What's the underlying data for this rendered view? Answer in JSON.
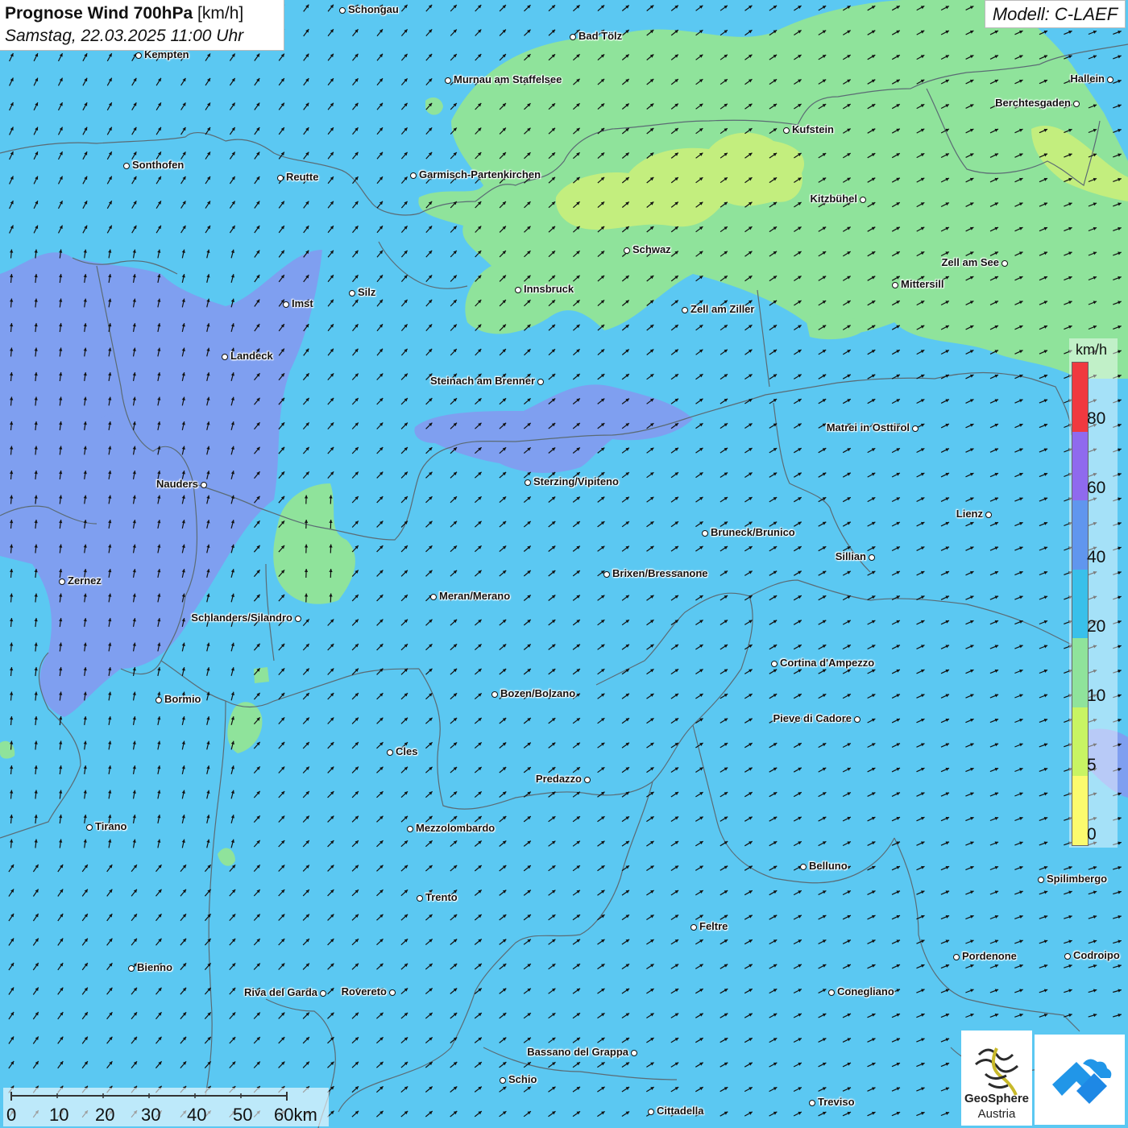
{
  "header": {
    "title_bold": "Prognose Wind 700hPa",
    "title_unit": "[km/h]",
    "datetime": "Samstag, 22.03.2025 11:00 Uhr",
    "model": "Modell: C-LAEF"
  },
  "colors": {
    "background_20_40": "#5bc8f2",
    "band_40_60": "#7f9ff0",
    "band_10_20": "#8fe39b",
    "band_5_10": "#c3ee7e",
    "border_line": "#5b6b74",
    "arrow": "#111111"
  },
  "cities": [
    {
      "name": "Schongau",
      "side": "r"
    },
    {
      "name": "Bad Tölz",
      "side": "r"
    },
    {
      "name": "Kempten",
      "side": "r"
    },
    {
      "name": "Murnau am Staffelsee",
      "side": "r"
    },
    {
      "name": "Hallein",
      "side": "l"
    },
    {
      "name": "Berchtesgaden",
      "side": "l"
    },
    {
      "name": "Kufstein",
      "side": "r"
    },
    {
      "name": "Sonthofen",
      "side": "r"
    },
    {
      "name": "Reutte",
      "side": "r"
    },
    {
      "name": "Garmisch-Partenkirchen",
      "side": "r"
    },
    {
      "name": "Kitzbühel",
      "side": "l"
    },
    {
      "name": "Schwaz",
      "side": "r"
    },
    {
      "name": "Zell am See",
      "side": "l"
    },
    {
      "name": "Mittersill",
      "side": "r"
    },
    {
      "name": "Innsbruck",
      "side": "r"
    },
    {
      "name": "Silz",
      "side": "r"
    },
    {
      "name": "Imst",
      "side": "r"
    },
    {
      "name": "Zell am Ziller",
      "side": "r"
    },
    {
      "name": "Landeck",
      "side": "r"
    },
    {
      "name": "Steinach am Brenner",
      "side": "l"
    },
    {
      "name": "Matrei in Osttirol",
      "side": "l"
    },
    {
      "name": "Nauders",
      "side": "l"
    },
    {
      "name": "Sterzing/Vipiteno",
      "side": "r"
    },
    {
      "name": "Lienz",
      "side": "l"
    },
    {
      "name": "Bruneck/Brunico",
      "side": "r"
    },
    {
      "name": "Sillian",
      "side": "l"
    },
    {
      "name": "Zernez",
      "side": "r"
    },
    {
      "name": "Brixen/Bressanone",
      "side": "r"
    },
    {
      "name": "Meran/Merano",
      "side": "r"
    },
    {
      "name": "Schlanders/Silandro",
      "side": "l"
    },
    {
      "name": "Cortina d'Ampezzo",
      "side": "r"
    },
    {
      "name": "Bozen/Bolzano",
      "side": "r"
    },
    {
      "name": "Bormio",
      "side": "r"
    },
    {
      "name": "Pieve di Cadore",
      "side": "l"
    },
    {
      "name": "Cles",
      "side": "r"
    },
    {
      "name": "Predazzo",
      "side": "l"
    },
    {
      "name": "Tirano",
      "side": "r"
    },
    {
      "name": "Mezzolombardo",
      "side": "r"
    },
    {
      "name": "Belluno",
      "side": "r"
    },
    {
      "name": "Spilimbergo",
      "side": "r"
    },
    {
      "name": "Trento",
      "side": "r"
    },
    {
      "name": "Feltre",
      "side": "r"
    },
    {
      "name": "Pordenone",
      "side": "r"
    },
    {
      "name": "Codroipo",
      "side": "r"
    },
    {
      "name": "Bienno",
      "side": "r"
    },
    {
      "name": "Riva del Garda",
      "side": "l"
    },
    {
      "name": "Rovereto",
      "side": "l"
    },
    {
      "name": "Conegliano",
      "side": "r"
    },
    {
      "name": "Bassano del Grappa",
      "side": "l"
    },
    {
      "name": "Schio",
      "side": "r"
    },
    {
      "name": "Treviso",
      "side": "r"
    },
    {
      "name": "Cittadella",
      "side": "r"
    }
  ],
  "legend": {
    "unit": "km/h",
    "ticks": [
      "0",
      "5",
      "10",
      "20",
      "40",
      "60",
      "80"
    ],
    "colors": [
      "#fbfb6e",
      "#c8f463",
      "#8fe39b",
      "#39c0ea",
      "#6096ee",
      "#8f6aee",
      "#f0393f"
    ]
  },
  "scale": {
    "labels": [
      "0",
      "10",
      "20",
      "30",
      "40",
      "50",
      "60km"
    ]
  },
  "logos": {
    "provider_name_line1": "GeoSphere",
    "provider_name_line2": "Austria"
  }
}
